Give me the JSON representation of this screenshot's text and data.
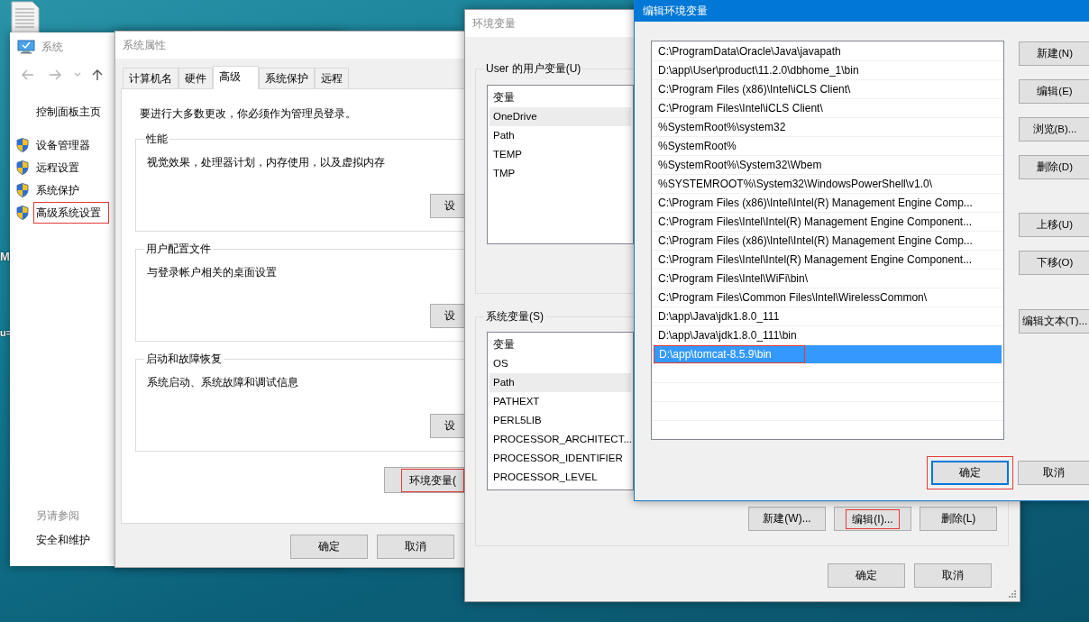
{
  "desktop": {
    "labels": [
      "M",
      "u="
    ]
  },
  "system_window": {
    "title": "系统",
    "home_link": "控制面板主页",
    "items": [
      {
        "label": "设备管理器",
        "highlighted": false
      },
      {
        "label": "远程设置",
        "highlighted": false
      },
      {
        "label": "系统保护",
        "highlighted": false
      },
      {
        "label": "高级系统设置",
        "highlighted": true
      }
    ],
    "see_also": "另请参阅",
    "see_also_links": [
      "安全和维护"
    ]
  },
  "system_properties": {
    "title": "系统属性",
    "tabs": [
      {
        "label": "计算机名",
        "selected": false
      },
      {
        "label": "硬件",
        "selected": false
      },
      {
        "label": "高级",
        "selected": true
      },
      {
        "label": "系统保护",
        "selected": false
      },
      {
        "label": "远程",
        "selected": false
      }
    ],
    "notice": "要进行大多数更改，你必须作为管理员登录。",
    "groups": [
      {
        "title": "性能",
        "description": "视觉效果，处理器计划，内存使用，以及虚拟内存",
        "button": "设"
      },
      {
        "title": "用户配置文件",
        "description": "与登录帐户相关的桌面设置",
        "button": "设"
      },
      {
        "title": "启动和故障恢复",
        "description": "系统启动、系统故障和调试信息",
        "button": "设"
      }
    ],
    "env_button": {
      "label": "环境变量(",
      "highlighted": true
    },
    "buttons": [
      "确定",
      "取消"
    ]
  },
  "environment_variables": {
    "title": "环境变量",
    "sections": [
      {
        "title": "User 的用户变量(U)",
        "column": "变量",
        "rows": [
          {
            "name": "OneDrive",
            "selected": true
          },
          {
            "name": "Path",
            "selected": false
          },
          {
            "name": "TEMP",
            "selected": false
          },
          {
            "name": "TMP",
            "selected": false
          }
        ]
      },
      {
        "title": "系统变量(S)",
        "column": "变量",
        "rows": [
          {
            "name": "OS",
            "selected": false
          },
          {
            "name": "Path",
            "selected": true
          },
          {
            "name": "PATHEXT",
            "selected": false
          },
          {
            "name": "PERL5LIB",
            "selected": false
          },
          {
            "name": "PROCESSOR_ARCHITECT...",
            "selected": false
          },
          {
            "name": "PROCESSOR_IDENTIFIER",
            "selected": false
          },
          {
            "name": "PROCESSOR_LEVEL",
            "selected": false
          }
        ],
        "buttons": [
          {
            "label": "新建(W)...",
            "highlighted": false
          },
          {
            "label": "编辑(I)...",
            "highlighted": true
          },
          {
            "label": "删除(L)",
            "highlighted": false
          }
        ]
      }
    ],
    "buttons": [
      "确定",
      "取消"
    ]
  },
  "edit_dialog": {
    "title": "编辑环境变量",
    "entries": [
      {
        "text": "C:\\ProgramData\\Oracle\\Java\\javapath",
        "selected": false,
        "highlighted": false
      },
      {
        "text": "D:\\app\\User\\product\\11.2.0\\dbhome_1\\bin",
        "selected": false,
        "highlighted": false
      },
      {
        "text": "C:\\Program Files (x86)\\Intel\\iCLS Client\\",
        "selected": false,
        "highlighted": false
      },
      {
        "text": "C:\\Program Files\\Intel\\iCLS Client\\",
        "selected": false,
        "highlighted": false
      },
      {
        "text": "%SystemRoot%\\system32",
        "selected": false,
        "highlighted": false
      },
      {
        "text": "%SystemRoot%",
        "selected": false,
        "highlighted": false
      },
      {
        "text": "%SystemRoot%\\System32\\Wbem",
        "selected": false,
        "highlighted": false
      },
      {
        "text": "%SYSTEMROOT%\\System32\\WindowsPowerShell\\v1.0\\",
        "selected": false,
        "highlighted": false
      },
      {
        "text": "C:\\Program Files (x86)\\Intel\\Intel(R) Management Engine Comp...",
        "selected": false,
        "highlighted": false
      },
      {
        "text": "C:\\Program Files\\Intel\\Intel(R) Management Engine Component...",
        "selected": false,
        "highlighted": false
      },
      {
        "text": "C:\\Program Files (x86)\\Intel\\Intel(R) Management Engine Comp...",
        "selected": false,
        "highlighted": false
      },
      {
        "text": "C:\\Program Files\\Intel\\Intel(R) Management Engine Component...",
        "selected": false,
        "highlighted": false
      },
      {
        "text": "C:\\Program Files\\Intel\\WiFi\\bin\\",
        "selected": false,
        "highlighted": false
      },
      {
        "text": "C:\\Program Files\\Common Files\\Intel\\WirelessCommon\\",
        "selected": false,
        "highlighted": false
      },
      {
        "text": "D:\\app\\Java\\jdk1.8.0_111",
        "selected": false,
        "highlighted": false
      },
      {
        "text": "D:\\app\\Java\\jdk1.8.0_111\\bin",
        "selected": false,
        "highlighted": false
      },
      {
        "text": "D:\\app\\tomcat-8.5.9\\bin",
        "selected": true,
        "highlighted": true
      }
    ],
    "side_buttons": [
      "新建(N)",
      "编辑(E)",
      "浏览(B)...",
      "删除(D)",
      "上移(U)",
      "下移(O)",
      "编辑文本(T)..."
    ],
    "buttons": [
      {
        "label": "确定",
        "default": true,
        "highlighted": true
      },
      {
        "label": "取消",
        "default": false,
        "highlighted": false
      }
    ]
  }
}
